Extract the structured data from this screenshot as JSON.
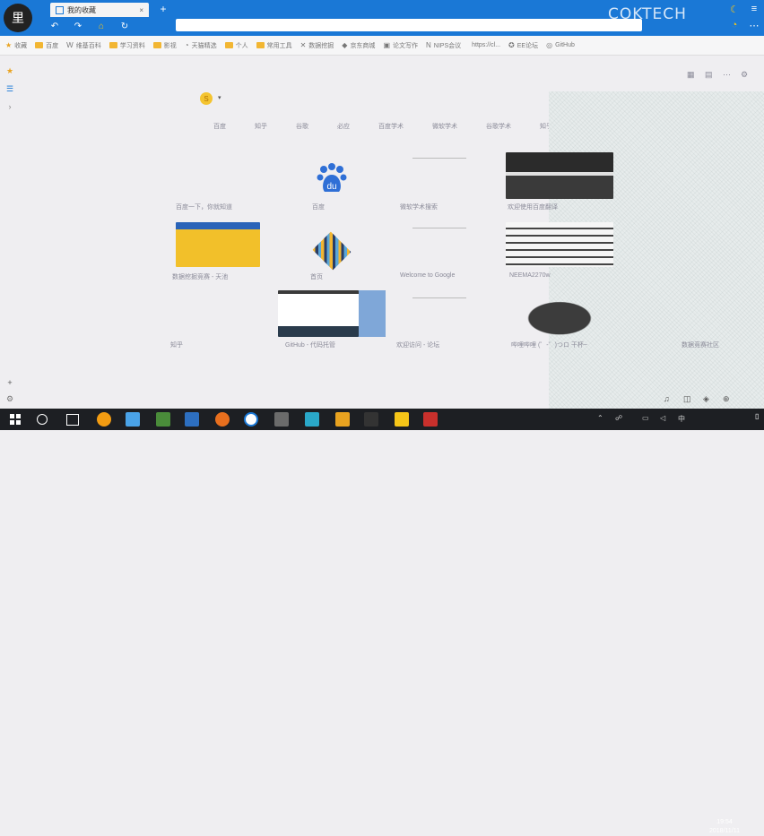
{
  "window": {
    "tab_title": "我的收藏",
    "tab_close": "×",
    "new_tab": "+",
    "watermark": "COKTECH"
  },
  "bookmarks": [
    {
      "label": "收藏",
      "type": "star"
    },
    {
      "label": "百度",
      "type": "folder"
    },
    {
      "label": "维基百科",
      "type": "glyph",
      "glyph": "W"
    },
    {
      "label": "学习资料",
      "type": "folder"
    },
    {
      "label": "影视",
      "type": "folder"
    },
    {
      "label": "天猫精选",
      "type": "glyph",
      "glyph": "◔"
    },
    {
      "label": "个人",
      "type": "folder"
    },
    {
      "label": "常用工具",
      "type": "folder"
    },
    {
      "label": "数据挖掘",
      "type": "glyph",
      "glyph": "✕"
    },
    {
      "label": "京东商城",
      "type": "glyph",
      "glyph": "◆"
    },
    {
      "label": "论文写作",
      "type": "glyph",
      "glyph": "▣"
    },
    {
      "label": "NIPS会议",
      "type": "glyph",
      "glyph": "N"
    },
    {
      "label": "https://cl...",
      "type": "glyph",
      "glyph": ""
    },
    {
      "label": "EE论坛",
      "type": "glyph",
      "glyph": "✪"
    },
    {
      "label": "GitHub",
      "type": "glyph",
      "glyph": "◎"
    }
  ],
  "search": {
    "engine": "S",
    "caret": "▾",
    "tabs": [
      "百度",
      "知乎",
      "谷歌",
      "必应",
      "百度学术",
      "微软学术",
      "谷歌学术",
      "知乎搜索"
    ]
  },
  "shortcuts": [
    {
      "label": "百度一下，你就知道"
    },
    {
      "label": "百度"
    },
    {
      "label": "微软学术搜索"
    },
    {
      "label": "欢迎使用百度翻译"
    },
    {
      "label": "数据挖掘竞赛 - 天池"
    },
    {
      "label": "首页"
    },
    {
      "label": "Welcome to Google"
    },
    {
      "label": "NEEMA2270w"
    },
    {
      "label": "知乎"
    },
    {
      "label": "GitHub - 代码托管"
    },
    {
      "label": "欢迎访问 - 论坛"
    },
    {
      "label": "哔哩哔哩 (゜-゜)つロ 干杯~"
    },
    {
      "label": "数据竞赛社区"
    }
  ],
  "sidebar": {
    "add": "+",
    "settings": "⚙"
  },
  "taskbar": {
    "time": "19:54",
    "date": "2018/11/11",
    "ime": "中"
  }
}
